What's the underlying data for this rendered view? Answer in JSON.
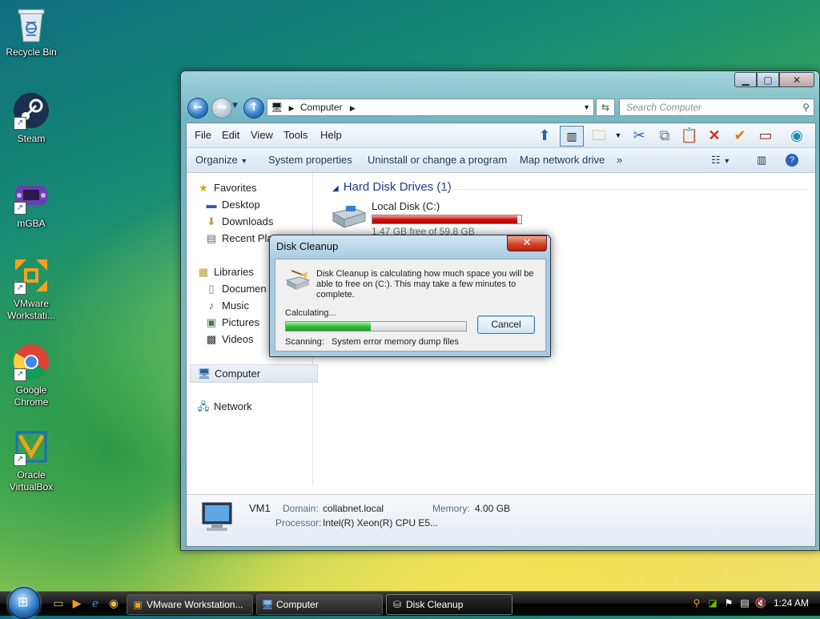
{
  "desktop": {
    "icons": [
      {
        "label": "Recycle Bin"
      },
      {
        "label": "Steam"
      },
      {
        "label": "mGBA"
      },
      {
        "label": "VMware Workstati..."
      },
      {
        "label": "Google Chrome"
      },
      {
        "label": "Oracle VirtualBox"
      }
    ]
  },
  "explorer": {
    "address": "Computer",
    "search_placeholder": "Search Computer",
    "menu": [
      "File",
      "Edit",
      "View",
      "Tools",
      "Help"
    ],
    "commands": [
      "Organize",
      "System properties",
      "Uninstall or change a program",
      "Map network drive",
      "»"
    ],
    "nav": {
      "favorites": "Favorites",
      "desktop": "Desktop",
      "downloads": "Downloads",
      "recent": "Recent Pla",
      "libraries": "Libraries",
      "documents": "Documen",
      "music": "Music",
      "pictures": "Pictures",
      "videos": "Videos",
      "computer": "Computer",
      "network": "Network"
    },
    "group_header": "Hard Disk Drives (1)",
    "disk": {
      "name": "Local Disk (C:)",
      "free_text": "1.47 GB free of 59.8 GB",
      "used_fraction": 0.975
    },
    "details": {
      "name": "VM1",
      "domain_label": "Domain:",
      "domain_value": "collabnet.local",
      "memory_label": "Memory:",
      "memory_value": "4.00 GB",
      "processor_label": "Processor:",
      "processor_value": "Intel(R) Xeon(R) CPU E5..."
    }
  },
  "dialog": {
    "title": "Disk Cleanup",
    "message": "Disk Cleanup is calculating how much space you will be able to free on  (C:). This may take a few minutes to complete.",
    "status": "Calculating...",
    "progress_percent": 47,
    "cancel_label": "Cancel",
    "scanning_label": "Scanning:",
    "scanning_value": "System error memory dump files"
  },
  "taskbar": {
    "tasks": [
      {
        "label": "VMware Workstation..."
      },
      {
        "label": "Computer"
      },
      {
        "label": "Disk Cleanup"
      }
    ],
    "clock": "1:24 AM"
  },
  "colors": {
    "disk_bar": "#d31010",
    "progress": "#2fbf3a",
    "link_blue": "#1e3a8a"
  }
}
